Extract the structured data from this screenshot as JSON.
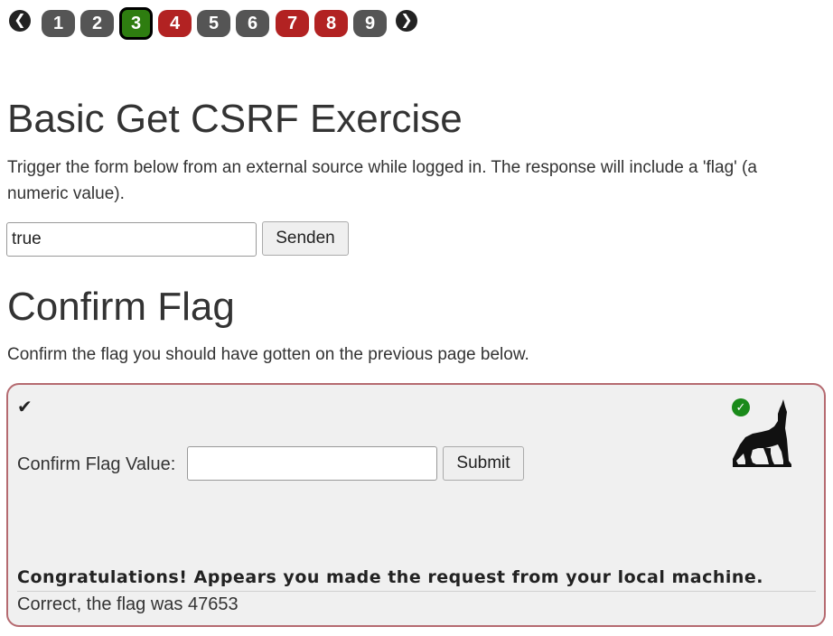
{
  "pagination": {
    "prev_icon": "arrow-left-icon",
    "next_icon": "arrow-right-icon",
    "pages": [
      {
        "label": "1",
        "state": "grey"
      },
      {
        "label": "2",
        "state": "grey"
      },
      {
        "label": "3",
        "state": "current-green"
      },
      {
        "label": "4",
        "state": "red"
      },
      {
        "label": "5",
        "state": "grey"
      },
      {
        "label": "6",
        "state": "grey"
      },
      {
        "label": "7",
        "state": "red"
      },
      {
        "label": "8",
        "state": "red"
      },
      {
        "label": "9",
        "state": "grey"
      }
    ]
  },
  "exercise": {
    "title": "Basic Get CSRF Exercise",
    "description": "Trigger the form below from an external source while logged in. The response will include a 'flag' (a numeric value).",
    "input_value": "true",
    "submit_label": "Senden"
  },
  "confirm": {
    "title": "Confirm Flag",
    "description": "Confirm the flag you should have gotten on the previous page below.",
    "label": "Confirm Flag Value:",
    "input_value": "",
    "submit_label": "Submit",
    "congrats": "Congratulations! Appears you made the request from your local machine.",
    "result": "Correct, the flag was 47653"
  },
  "colors": {
    "grey": "#555555",
    "red": "#b22222",
    "green": "#2e7d10",
    "panel_border": "#b56a70",
    "panel_bg": "#f0f0f0"
  }
}
